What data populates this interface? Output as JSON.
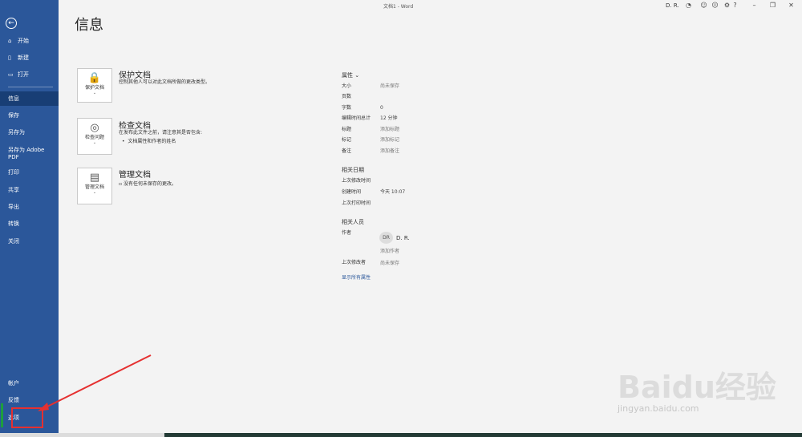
{
  "window": {
    "title": "文档1 - Word",
    "user": "D. R."
  },
  "sidebar": {
    "back_icon": "back-arrow-icon",
    "items": [
      {
        "label": "开始",
        "icon": "home-icon"
      },
      {
        "label": "新建",
        "icon": "new-doc-icon"
      },
      {
        "label": "打开",
        "icon": "folder-icon"
      },
      {
        "label": "信息",
        "active": true
      },
      {
        "label": "保存"
      },
      {
        "label": "另存为"
      },
      {
        "label": "另存为 Adobe PDF"
      },
      {
        "label": "打印"
      },
      {
        "label": "共享"
      },
      {
        "label": "导出"
      },
      {
        "label": "转换"
      },
      {
        "label": "关闭"
      }
    ],
    "bottom": [
      {
        "label": "帐户"
      },
      {
        "label": "反馈"
      },
      {
        "label": "选项"
      }
    ]
  },
  "page": {
    "title": "信息"
  },
  "sections": [
    {
      "button": "保护文档",
      "title": "保护文档",
      "desc": "控制其他人可以对此文档所做的更改类型。"
    },
    {
      "button": "检查问题",
      "title": "检查文档",
      "desc": "在发布此文件之前，请注意其是否包含:",
      "bullet": "文档属性和作者的姓名"
    },
    {
      "button": "管理文档",
      "title": "管理文档",
      "desc": "没有任何未保存的更改。"
    }
  ],
  "properties": {
    "header": "属性",
    "rows": [
      {
        "key": "大小",
        "value": "尚未保存"
      },
      {
        "key": "页数",
        "value": ""
      },
      {
        "key": "字数",
        "value": "0"
      },
      {
        "key": "编辑时间总计",
        "value": "12 分钟"
      },
      {
        "key": "标题",
        "value": "添加标题"
      },
      {
        "key": "标记",
        "value": "添加标记"
      },
      {
        "key": "备注",
        "value": "添加备注"
      }
    ],
    "dates_header": "相关日期",
    "dates": [
      {
        "key": "上次修改时间",
        "value": ""
      },
      {
        "key": "创建时间",
        "value": "今天 10:07"
      },
      {
        "key": "上次打印时间",
        "value": ""
      }
    ],
    "people_header": "相关人员",
    "author_label": "作者",
    "author_initials": "DR",
    "author_name": "D. R.",
    "add_author": "添加作者",
    "last_modified_by_label": "上次修改者",
    "last_modified_by": "尚未保存",
    "show_all": "显示所有属性"
  },
  "watermark": {
    "text": "Baidu经验",
    "sub": "jingyan.baidu.com"
  },
  "colors": {
    "sidebar": "#2b579a",
    "active": "#183e75",
    "highlight": "#e53030"
  }
}
